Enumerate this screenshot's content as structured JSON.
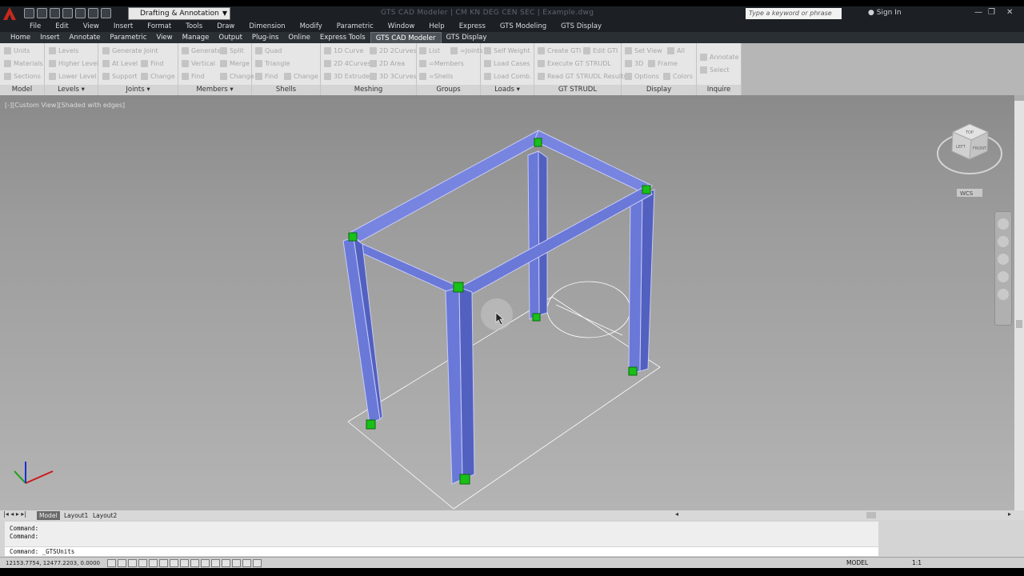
{
  "titlebar": {
    "workspace": "Drafting & Annotation",
    "title": "GTS CAD Modeler  |  CM KN DEG CEN SEC  |  Example.dwg",
    "search_placeholder": "Type a keyword or phrase",
    "signin": "Sign In"
  },
  "menubar": [
    "File",
    "Edit",
    "View",
    "Insert",
    "Format",
    "Tools",
    "Draw",
    "Dimension",
    "Modify",
    "Parametric",
    "Window",
    "Help",
    "Express",
    "GTS Modeling",
    "GTS Display"
  ],
  "tabs": [
    "Home",
    "Insert",
    "Annotate",
    "Parametric",
    "View",
    "Manage",
    "Output",
    "Plug-ins",
    "Online",
    "Express Tools",
    "GTS CAD Modeler",
    "GTS Display"
  ],
  "active_tab": "GTS CAD Modeler",
  "ribbon": {
    "model": {
      "title": "Model",
      "items": [
        "Units",
        "Materials",
        "Sections"
      ]
    },
    "levels": {
      "title": "Levels",
      "items": [
        "Levels",
        "Higher Level",
        "Lower Level"
      ]
    },
    "joints": {
      "title": "Joints",
      "items": [
        "Generate Joint",
        "At Level",
        "Support",
        "Find",
        "Change"
      ]
    },
    "members": {
      "title": "Members",
      "items": [
        "Generate",
        "Vertical",
        "Find",
        "Split",
        "Merge",
        "Change"
      ]
    },
    "shells": {
      "title": "Shells",
      "items": [
        "Quad",
        "Triangle",
        "Find",
        "Change"
      ]
    },
    "meshing": {
      "title": "Meshing",
      "items": [
        "1D Curve",
        "2D 4Curves",
        "3D Extrude",
        "2D 2Curves",
        "2D Area",
        "3D 3Curves"
      ]
    },
    "groups": {
      "title": "Groups",
      "items": [
        "List",
        "=Joints",
        "=Members",
        "=Shells"
      ]
    },
    "loads": {
      "title": "Loads",
      "items": [
        "Self Weight",
        "Load Cases",
        "Load Comb."
      ]
    },
    "gtstrudl": {
      "title": "GT STRUDL",
      "items": [
        "Create GTI",
        "Edit GTI",
        "Execute GT STRUDL",
        "Read GT STRUDL Results"
      ]
    },
    "display": {
      "title": "Display",
      "items": [
        "Set View",
        "All",
        "3D",
        "Frame",
        "Options",
        "Colors"
      ]
    },
    "inquire": {
      "title": "Inquire",
      "items": [
        "Annotate",
        "Select"
      ]
    }
  },
  "viewport": {
    "label": "[-][Custom View][Shaded with edges]",
    "wcs": "WCS",
    "viewcube_top": "TOP",
    "viewcube_left": "LEFT",
    "viewcube_front": "FRONT"
  },
  "layout_tabs": [
    "Model",
    "Layout1",
    "Layout2"
  ],
  "command": {
    "history": [
      "Command:",
      "Command:"
    ],
    "input": "Command: _GTSUnits"
  },
  "status": {
    "coords": "12153.7754, 12477.2203, 0.0000",
    "model": "MODEL",
    "scale": "1:1"
  },
  "colors": {
    "member_fill": "#6a78d8",
    "joint": "#18c018"
  }
}
